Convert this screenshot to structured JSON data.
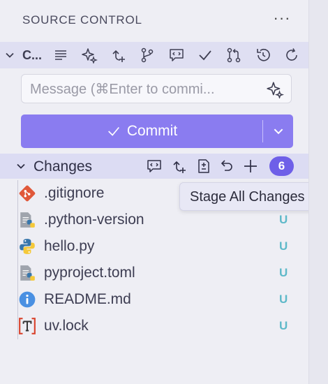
{
  "header": {
    "title": "SOURCE CONTROL",
    "more_label": "···"
  },
  "repository": {
    "name": "C...",
    "toolbar_icons": [
      "list-icon",
      "sparkle-icon",
      "sync-changes-icon",
      "branch-icon",
      "comment-code-icon",
      "check-icon",
      "pull-request-icon",
      "history-icon",
      "refresh-icon"
    ]
  },
  "commit": {
    "placeholder": "Message (⌘Enter to commi...",
    "button_label": "Commit",
    "accent": "#8a7cf0"
  },
  "changes": {
    "label": "Changes",
    "count": "6",
    "badge_color": "#6e5fe8",
    "tooltip": "Stage All Changes",
    "files": [
      {
        "name": ".gitignore",
        "status": "",
        "icon": "git-icon"
      },
      {
        "name": ".python-version",
        "status": "U",
        "icon": "python-file-icon"
      },
      {
        "name": "hello.py",
        "status": "U",
        "icon": "python-icon"
      },
      {
        "name": "pyproject.toml",
        "status": "U",
        "icon": "python-file-icon"
      },
      {
        "name": "README.md",
        "status": "U",
        "icon": "info-icon"
      },
      {
        "name": "uv.lock",
        "status": "U",
        "icon": "text-file-icon"
      }
    ]
  }
}
